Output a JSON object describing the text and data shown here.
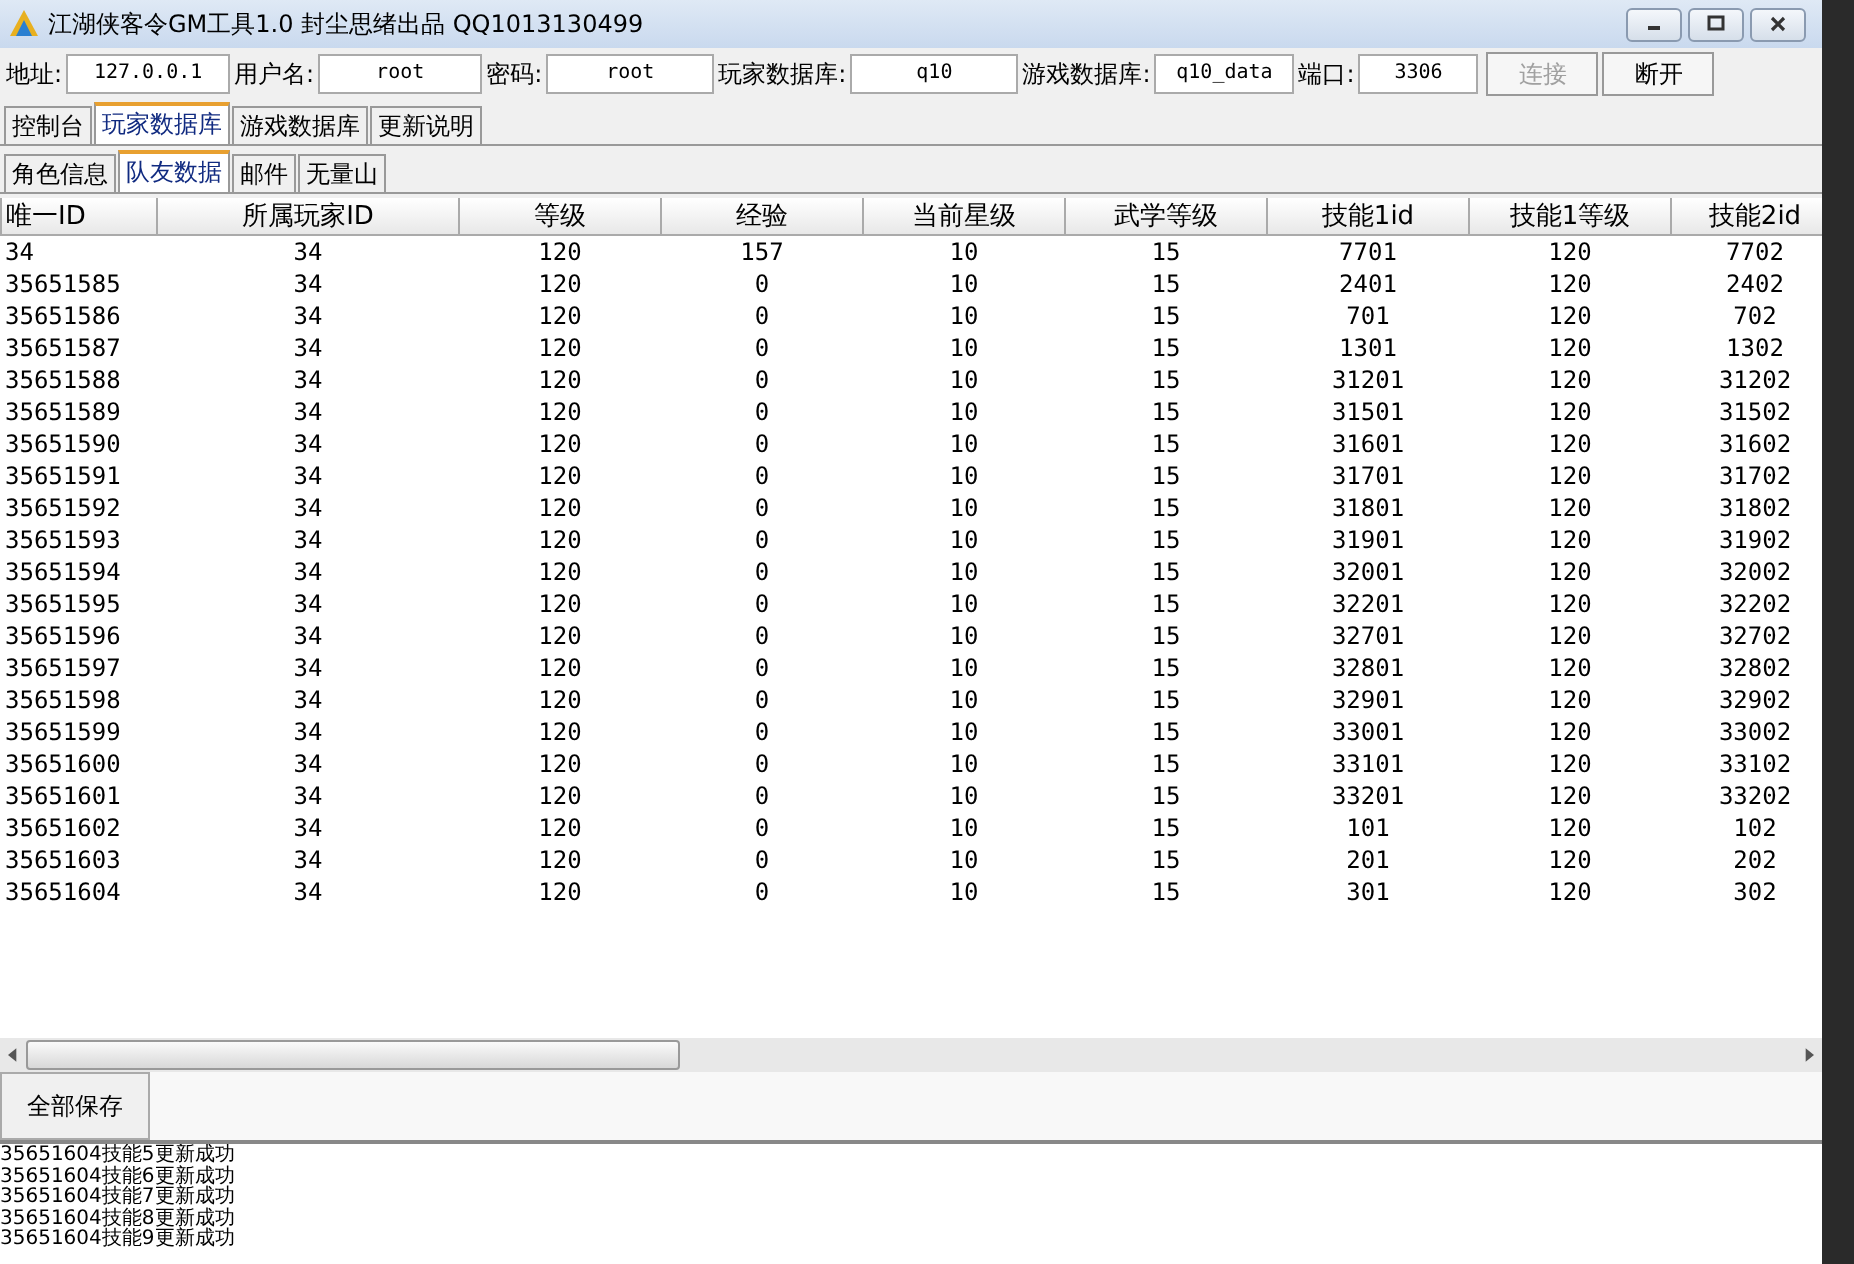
{
  "window": {
    "title": "江湖侠客令GM工具1.0 封尘思绪出品 QQ1013130499"
  },
  "connection": {
    "fields": [
      {
        "label": "地址:",
        "value": "127.0.0.1"
      },
      {
        "label": "用户名:",
        "value": "root"
      },
      {
        "label": "密码:",
        "value": "root"
      },
      {
        "label": "玩家数据库:",
        "value": "q10"
      },
      {
        "label": "游戏数据库:",
        "value": "q10_data"
      },
      {
        "label": "端口:",
        "value": "3306"
      }
    ],
    "buttons": [
      {
        "label": "连接",
        "disabled": true
      },
      {
        "label": "断开",
        "disabled": false
      }
    ]
  },
  "tabs": [
    {
      "label": "控制台",
      "selected": false
    },
    {
      "label": "玩家数据库",
      "selected": true
    },
    {
      "label": "游戏数据库",
      "selected": false
    },
    {
      "label": "更新说明",
      "selected": false
    }
  ],
  "subtabs": [
    {
      "label": "角色信息",
      "selected": false
    },
    {
      "label": "队友数据",
      "selected": true
    },
    {
      "label": "邮件",
      "selected": false
    },
    {
      "label": "无量山",
      "selected": false
    }
  ],
  "table": {
    "columns": [
      "唯一ID",
      "所属玩家ID",
      "等级",
      "经验",
      "当前星级",
      "武学等级",
      "技能1id",
      "技能1等级",
      "技能2id"
    ],
    "rows": [
      [
        "34",
        "34",
        "120",
        "157",
        "10",
        "15",
        "7701",
        "120",
        "7702"
      ],
      [
        "35651585",
        "34",
        "120",
        "0",
        "10",
        "15",
        "2401",
        "120",
        "2402"
      ],
      [
        "35651586",
        "34",
        "120",
        "0",
        "10",
        "15",
        "701",
        "120",
        "702"
      ],
      [
        "35651587",
        "34",
        "120",
        "0",
        "10",
        "15",
        "1301",
        "120",
        "1302"
      ],
      [
        "35651588",
        "34",
        "120",
        "0",
        "10",
        "15",
        "31201",
        "120",
        "31202"
      ],
      [
        "35651589",
        "34",
        "120",
        "0",
        "10",
        "15",
        "31501",
        "120",
        "31502"
      ],
      [
        "35651590",
        "34",
        "120",
        "0",
        "10",
        "15",
        "31601",
        "120",
        "31602"
      ],
      [
        "35651591",
        "34",
        "120",
        "0",
        "10",
        "15",
        "31701",
        "120",
        "31702"
      ],
      [
        "35651592",
        "34",
        "120",
        "0",
        "10",
        "15",
        "31801",
        "120",
        "31802"
      ],
      [
        "35651593",
        "34",
        "120",
        "0",
        "10",
        "15",
        "31901",
        "120",
        "31902"
      ],
      [
        "35651594",
        "34",
        "120",
        "0",
        "10",
        "15",
        "32001",
        "120",
        "32002"
      ],
      [
        "35651595",
        "34",
        "120",
        "0",
        "10",
        "15",
        "32201",
        "120",
        "32202"
      ],
      [
        "35651596",
        "34",
        "120",
        "0",
        "10",
        "15",
        "32701",
        "120",
        "32702"
      ],
      [
        "35651597",
        "34",
        "120",
        "0",
        "10",
        "15",
        "32801",
        "120",
        "32802"
      ],
      [
        "35651598",
        "34",
        "120",
        "0",
        "10",
        "15",
        "32901",
        "120",
        "32902"
      ],
      [
        "35651599",
        "34",
        "120",
        "0",
        "10",
        "15",
        "33001",
        "120",
        "33002"
      ],
      [
        "35651600",
        "34",
        "120",
        "0",
        "10",
        "15",
        "33101",
        "120",
        "33102"
      ],
      [
        "35651601",
        "34",
        "120",
        "0",
        "10",
        "15",
        "33201",
        "120",
        "33202"
      ],
      [
        "35651602",
        "34",
        "120",
        "0",
        "10",
        "15",
        "101",
        "120",
        "102"
      ],
      [
        "35651603",
        "34",
        "120",
        "0",
        "10",
        "15",
        "201",
        "120",
        "202"
      ],
      [
        "35651604",
        "34",
        "120",
        "0",
        "10",
        "15",
        "301",
        "120",
        "302"
      ]
    ]
  },
  "save_button": "全部保存",
  "log": [
    "35651604技能5更新成功",
    "35651604技能6更新成功",
    "35651604技能7更新成功",
    "35651604技能8更新成功",
    "35651604技能9更新成功"
  ]
}
